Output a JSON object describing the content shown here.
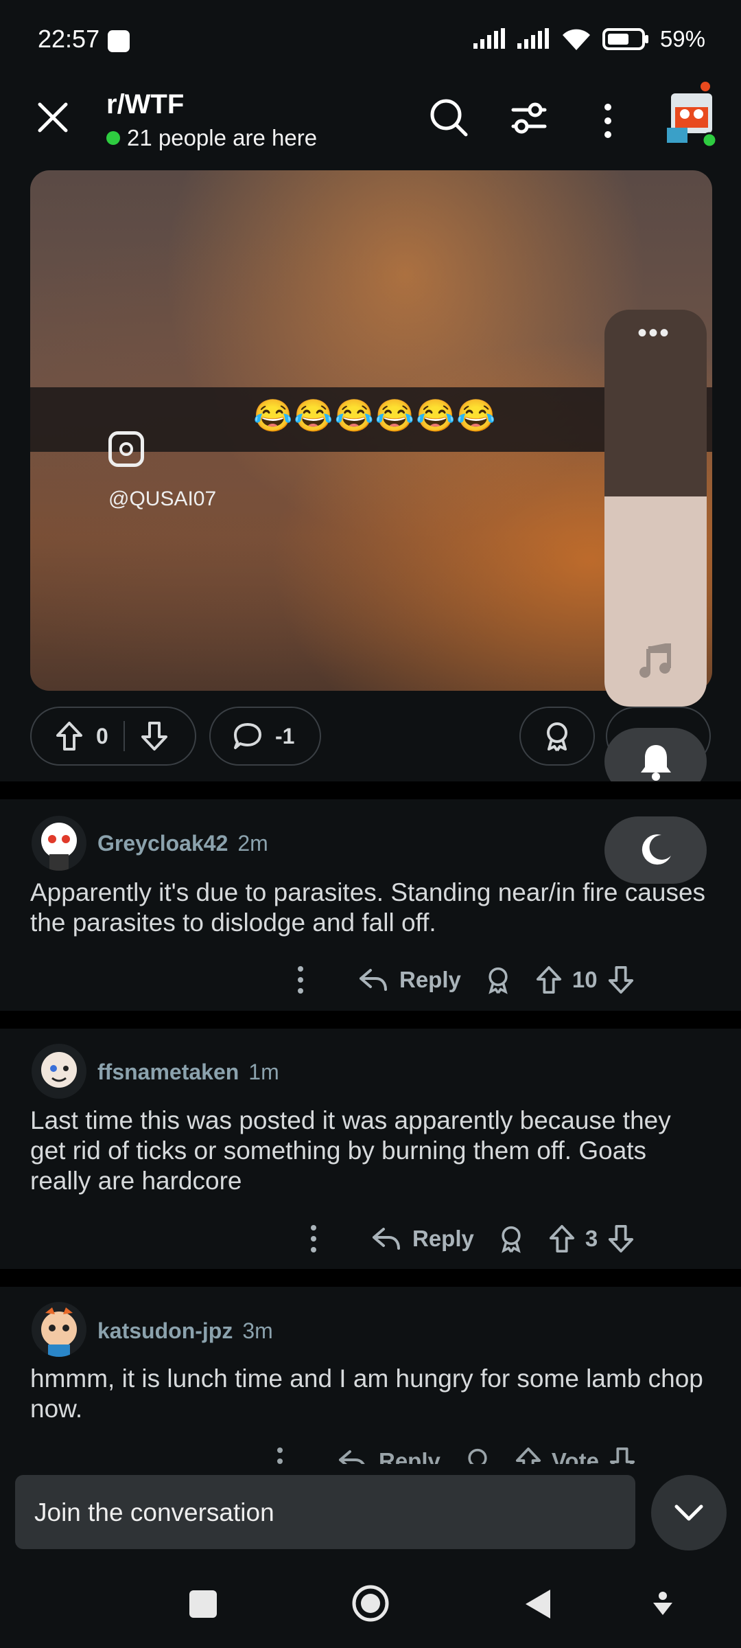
{
  "status": {
    "time": "22:57",
    "battery": "59%"
  },
  "header": {
    "subreddit": "r/WTF",
    "presence": "21 people are here"
  },
  "video": {
    "emojis": "😂😂😂😂😂😂",
    "handle": "@QUSAI07"
  },
  "post_actions": {
    "score": "0",
    "comments": "-1"
  },
  "comments": [
    {
      "user": "Greycloak42",
      "time": "2m",
      "text": "Apparently it's due to parasites. Standing near/in fire causes the parasites to dislodge and fall off.",
      "reply": "Reply",
      "score": "10"
    },
    {
      "user": "ffsnametaken",
      "time": "1m",
      "text": "Last time this was posted it was apparently because they get rid of ticks or something by burning them off. Goats really are hardcore",
      "reply": "Reply",
      "score": "3"
    },
    {
      "user": "katsudon-jpz",
      "time": "3m",
      "text": "hmmm, it is lunch time and I am hungry for some lamb chop now.",
      "reply": "Reply",
      "score": "Vote"
    }
  ],
  "composer": {
    "placeholder": "Join the conversation"
  },
  "colors": {
    "background": "#0e1113",
    "accent_online": "#2ecc40",
    "muted": "#8ba2ad"
  },
  "volume_level_percent": 53
}
